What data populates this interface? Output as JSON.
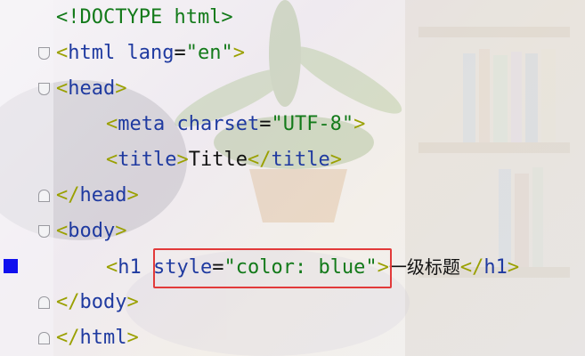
{
  "editor": {
    "lines": {
      "l1": {
        "text": "<!DOCTYPE html>"
      },
      "l2": {
        "open": "<",
        "tag": "html",
        "attr": "lang",
        "eq": "=",
        "val": "\"en\"",
        "close": ">"
      },
      "l3": {
        "open": "<",
        "tag": "head",
        "close": ">"
      },
      "l4": {
        "open": "<",
        "tag": "meta",
        "attr": "charset",
        "eq": "=",
        "val": "\"UTF-8\"",
        "close": ">"
      },
      "l5": {
        "open": "<",
        "tag": "title",
        "close": ">",
        "text": "Title",
        "endopen": "</",
        "endtag": "title",
        "endclose": ">"
      },
      "l6": {
        "open": "</",
        "tag": "head",
        "close": ">"
      },
      "l7": {
        "open": "<",
        "tag": "body",
        "close": ">"
      },
      "l8": {
        "open": "<",
        "tag": "h1",
        "attr": "style",
        "eq": "=",
        "val": "\"color: blue\"",
        "close": ">",
        "text": "一级标题",
        "endopen": "</",
        "endtag": "h1",
        "endclose": ">"
      },
      "l9": {
        "open": "</",
        "tag": "body",
        "close": ">"
      },
      "l10": {
        "open": "</",
        "tag": "html",
        "close": ">"
      }
    },
    "highlight_color": "#e23a3a",
    "breakpoint_color": "#1010ee"
  }
}
